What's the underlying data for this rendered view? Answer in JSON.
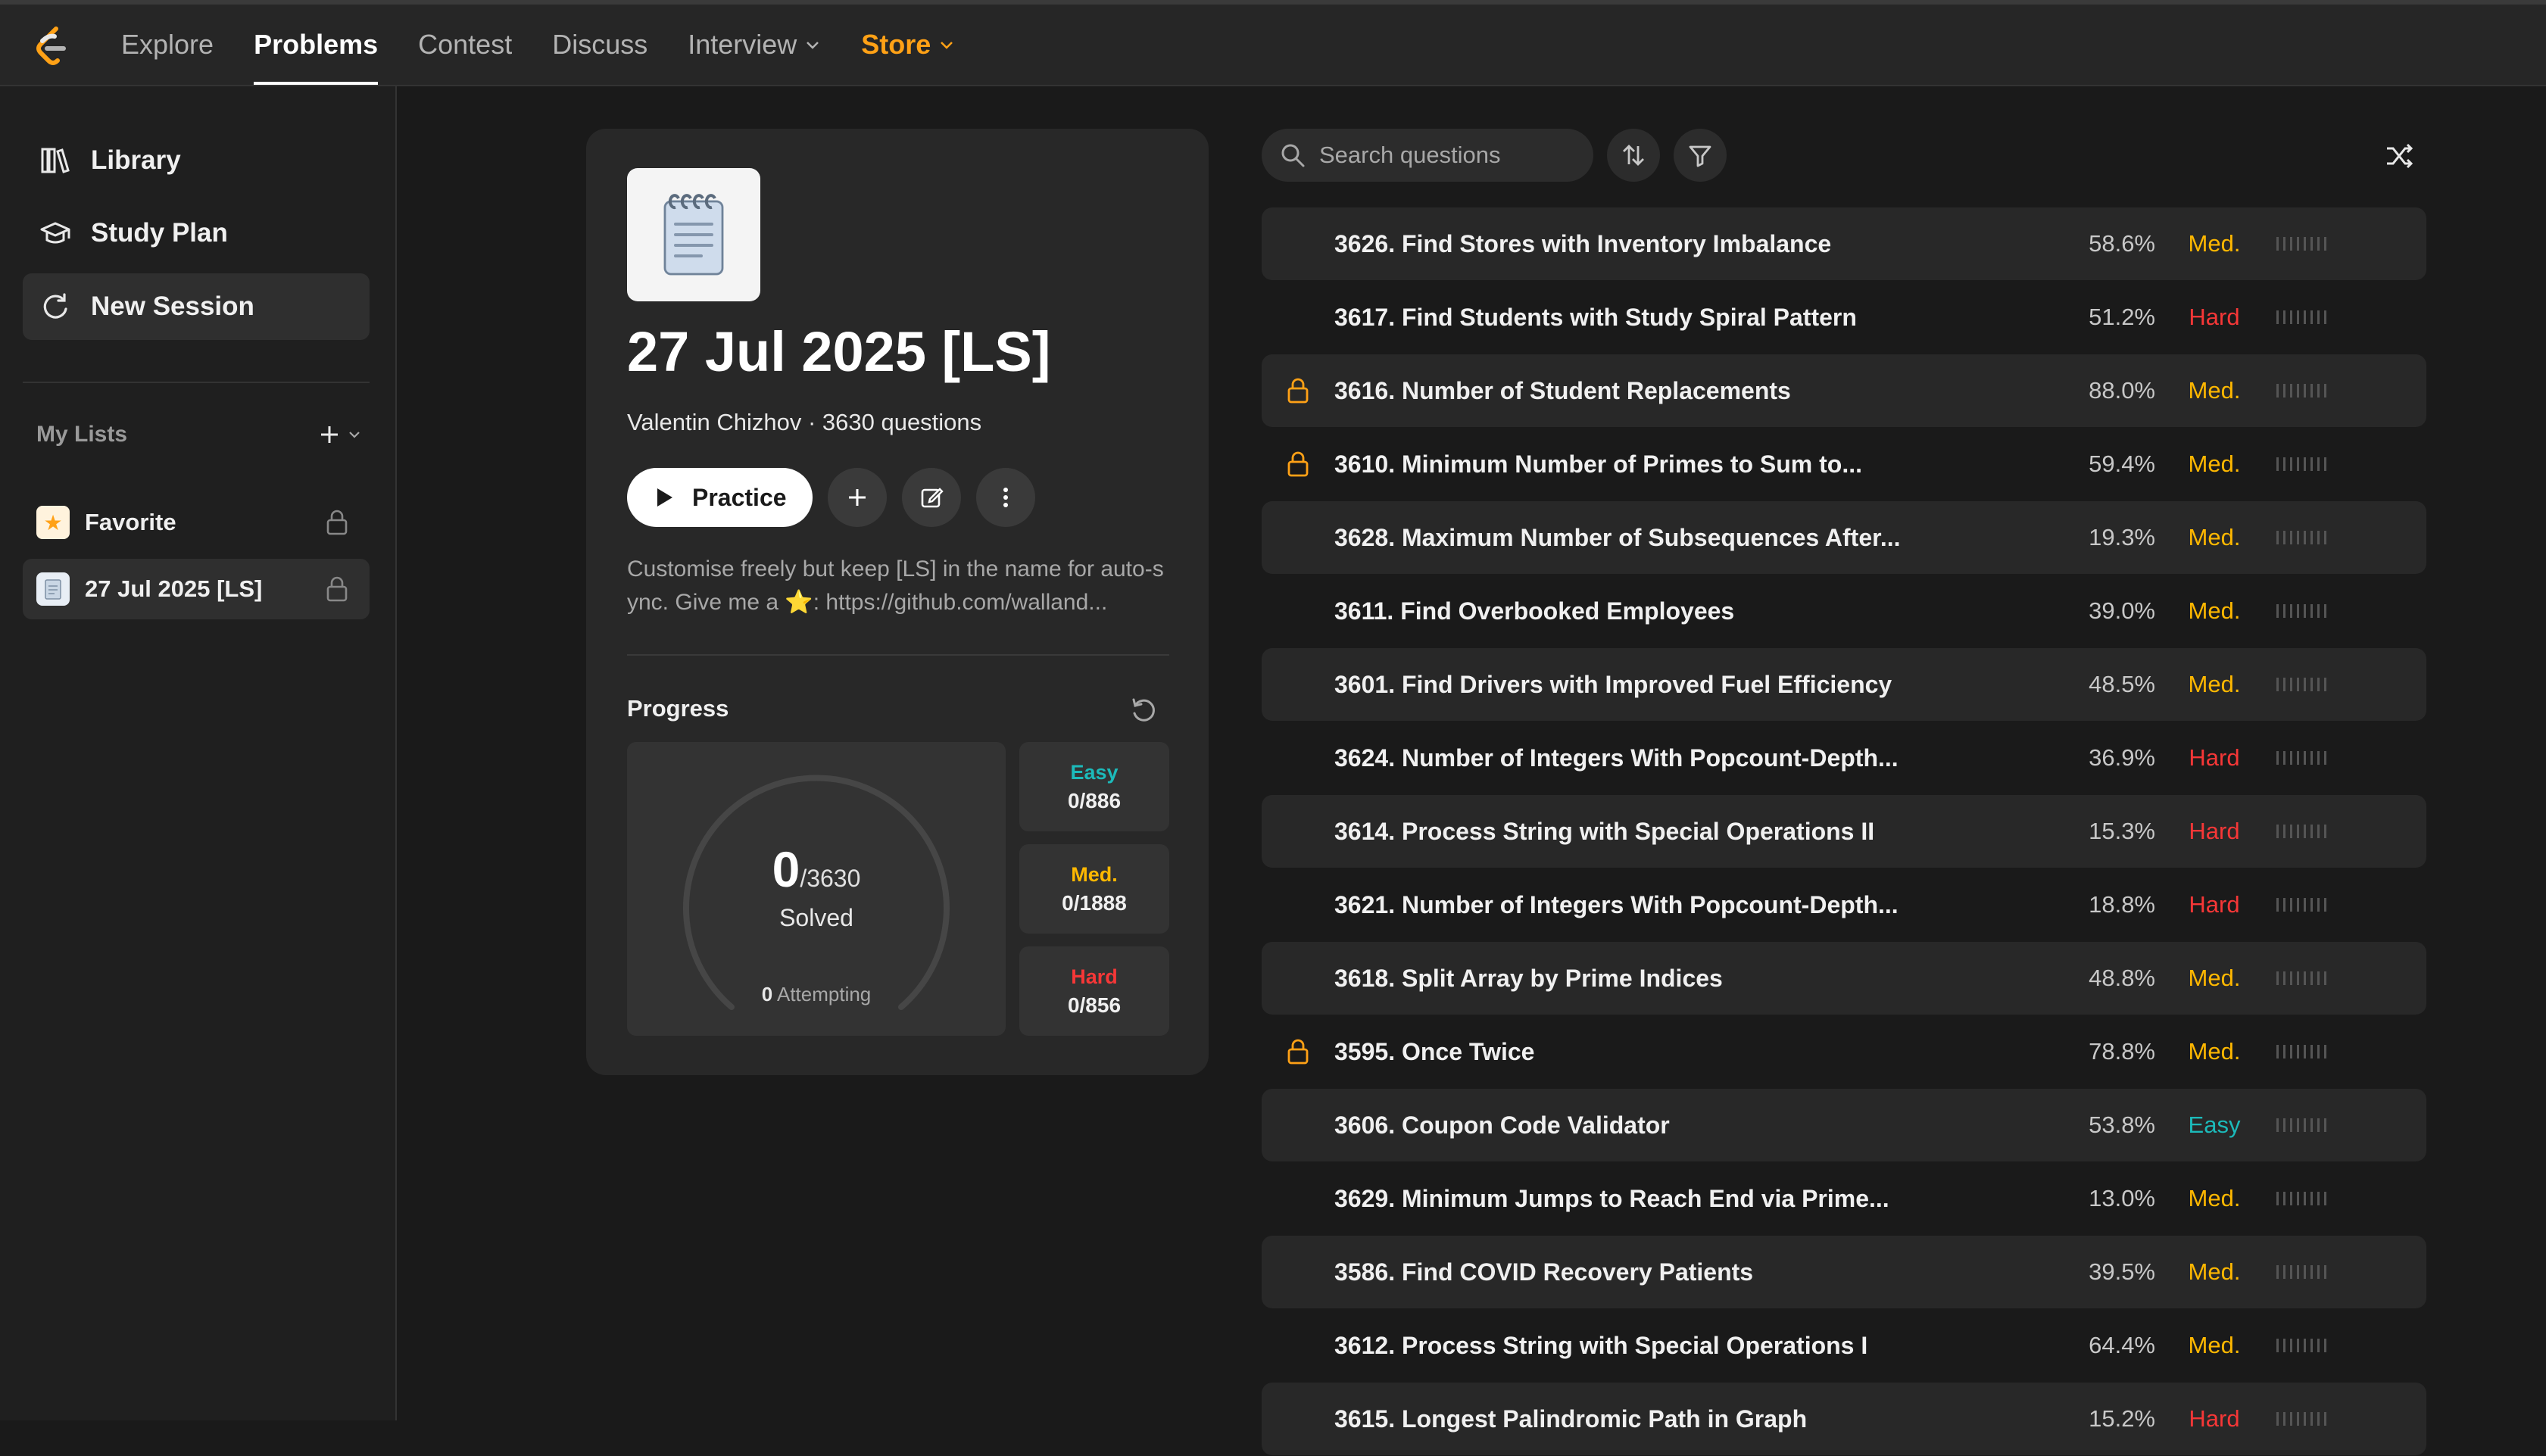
{
  "nav": {
    "links": [
      {
        "label": "Explore"
      },
      {
        "label": "Problems"
      },
      {
        "label": "Contest"
      },
      {
        "label": "Discuss"
      },
      {
        "label": "Interview"
      },
      {
        "label": "Store"
      }
    ],
    "active": "Problems",
    "accent_color": "#ffa116"
  },
  "sidebar": {
    "items": [
      {
        "label": "Library",
        "icon": "library-icon"
      },
      {
        "label": "Study Plan",
        "icon": "graduation-cap-icon"
      },
      {
        "label": "New Session",
        "icon": "refresh-icon"
      }
    ],
    "my_lists_label": "My Lists",
    "lists": [
      {
        "label": "Favorite",
        "icon": "star-icon"
      },
      {
        "label": "27 Jul 2025 [LS]",
        "icon": "notepad-icon"
      }
    ]
  },
  "detail": {
    "title": "27 Jul 2025 [LS]",
    "subtitle": "Valentin Chizhov · 3630 questions",
    "practice_label": "Practice",
    "description": "Customise freely but keep [LS] in the name for auto-sync. Give me a ⭐: https://github.com/walland...",
    "progress_label": "Progress",
    "solved": "0",
    "total": "/3630",
    "solved_label": "Solved",
    "attempting_count": "0",
    "attempting_label": "Attempting",
    "difficulty": [
      {
        "name": "Easy",
        "value": "0/886",
        "color": "#1cbaba"
      },
      {
        "name": "Med.",
        "value": "0/1888",
        "color": "#ffb800"
      },
      {
        "name": "Hard",
        "value": "0/856",
        "color": "#f63737"
      }
    ]
  },
  "search": {
    "placeholder": "Search questions"
  },
  "questions": [
    {
      "title": "3626. Find Stores with Inventory Imbalance",
      "rate": "58.6%",
      "difficulty": "Med.",
      "locked": false
    },
    {
      "title": "3617. Find Students with Study Spiral Pattern",
      "rate": "51.2%",
      "difficulty": "Hard",
      "locked": false
    },
    {
      "title": "3616. Number of Student Replacements",
      "rate": "88.0%",
      "difficulty": "Med.",
      "locked": true
    },
    {
      "title": "3610. Minimum Number of Primes to Sum to...",
      "rate": "59.4%",
      "difficulty": "Med.",
      "locked": true
    },
    {
      "title": "3628. Maximum Number of Subsequences After...",
      "rate": "19.3%",
      "difficulty": "Med.",
      "locked": false
    },
    {
      "title": "3611. Find Overbooked Employees",
      "rate": "39.0%",
      "difficulty": "Med.",
      "locked": false
    },
    {
      "title": "3601. Find Drivers with Improved Fuel Efficiency",
      "rate": "48.5%",
      "difficulty": "Med.",
      "locked": false
    },
    {
      "title": "3624. Number of Integers With Popcount-Depth...",
      "rate": "36.9%",
      "difficulty": "Hard",
      "locked": false
    },
    {
      "title": "3614. Process String with Special Operations II",
      "rate": "15.3%",
      "difficulty": "Hard",
      "locked": false
    },
    {
      "title": "3621. Number of Integers With Popcount-Depth...",
      "rate": "18.8%",
      "difficulty": "Hard",
      "locked": false
    },
    {
      "title": "3618. Split Array by Prime Indices",
      "rate": "48.8%",
      "difficulty": "Med.",
      "locked": false
    },
    {
      "title": "3595. Once Twice",
      "rate": "78.8%",
      "difficulty": "Med.",
      "locked": true
    },
    {
      "title": "3606. Coupon Code Validator",
      "rate": "53.8%",
      "difficulty": "Easy",
      "locked": false
    },
    {
      "title": "3629. Minimum Jumps to Reach End via Prime...",
      "rate": "13.0%",
      "difficulty": "Med.",
      "locked": false
    },
    {
      "title": "3586. Find COVID Recovery Patients",
      "rate": "39.5%",
      "difficulty": "Med.",
      "locked": false
    },
    {
      "title": "3612. Process String with Special Operations I",
      "rate": "64.4%",
      "difficulty": "Med.",
      "locked": false
    },
    {
      "title": "3615. Longest Palindromic Path in Graph",
      "rate": "15.2%",
      "difficulty": "Hard",
      "locked": false
    }
  ]
}
